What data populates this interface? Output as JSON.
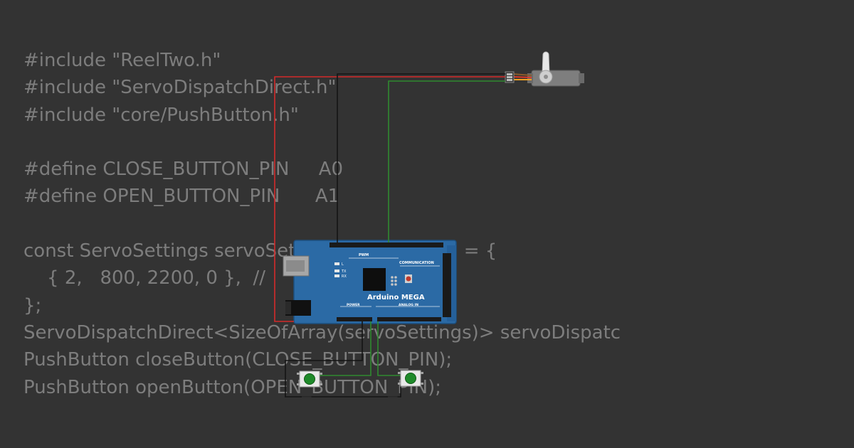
{
  "code_lines": [
    "#include \"ReelTwo.h\"",
    "#include \"ServoDispatchDirect.h\"",
    "#include \"core/PushButton.h\"",
    "",
    "#define CLOSE_BUTTON_PIN     A0",
    "#define OPEN_BUTTON_PIN      A1",
    "",
    "const ServoSettings servoSettings[] PROGMEM = {",
    "    { 2,   800, 2200, 0 },  // ",
    "};",
    "ServoDispatchDirect<SizeOfArray(servoSettings)> servoDispatc",
    "PushButton closeButton(CLOSE_BUTTON_PIN);",
    "PushButton openButton(OPEN_BUTTON_PIN);"
  ],
  "board": {
    "name": "Arduino MEGA",
    "pwm_label": "PWM",
    "communication_label": "COMMUNICATION",
    "power_label": "POWER",
    "analog_label": "ANALOG IN",
    "led_labels": [
      "L",
      "TX",
      "RX"
    ]
  },
  "colors": {
    "background": "#333333",
    "code_text": "#7d7d7d",
    "board": "#2b6aa5",
    "wire_power": "#d42a2a",
    "wire_ground": "#151515",
    "wire_signal": "#2f8a2f",
    "button": "#1f8a2a"
  },
  "components": [
    "servo",
    "arduino-mega",
    "push-button-close",
    "push-button-open"
  ]
}
